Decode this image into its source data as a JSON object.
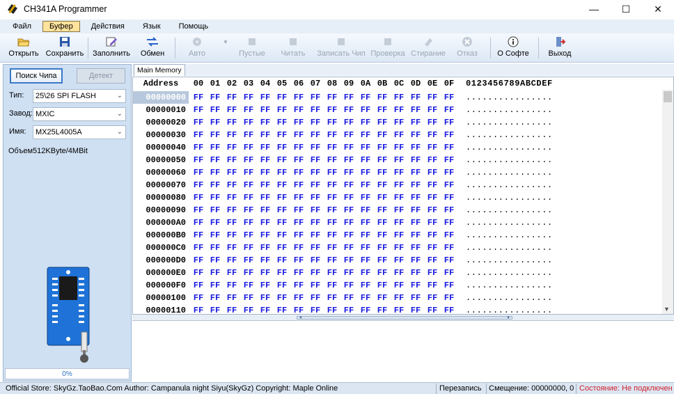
{
  "window": {
    "title": "CH341A Programmer",
    "minimize": "—",
    "maximize": "☐",
    "close": "✕"
  },
  "menu": {
    "items": [
      {
        "label": "Файл",
        "active": false
      },
      {
        "label": "Буфер",
        "active": true
      },
      {
        "label": "Действия",
        "active": false
      },
      {
        "label": "Язык",
        "active": false
      },
      {
        "label": "Помощь",
        "active": false
      }
    ]
  },
  "toolbar": {
    "open": "Открыть",
    "save": "Сохранить",
    "fill": "Заполнить",
    "swap": "Обмен",
    "auto": "Авто",
    "blank": "Пустые",
    "read": "Читать",
    "write": "Записать Чип",
    "verify": "Проверка",
    "erase": "Стирание",
    "cancel": "Отказ",
    "about": "О Софте",
    "exit": "Выход"
  },
  "left": {
    "search_btn": "Поиск Чипа",
    "detect_btn": "Детект",
    "type_label": "Тип:",
    "type_value": "25\\26 SPI FLASH",
    "vendor_label": "Завод:",
    "vendor_value": "MXIC",
    "name_label": "Имя:",
    "name_value": "MX25L4005A",
    "size_label": "Объем",
    "size_value": "512KByte/4MBit",
    "progress": "0%"
  },
  "memory": {
    "tab": "Main Memory",
    "address_header": "Address",
    "columns": [
      "00",
      "01",
      "02",
      "03",
      "04",
      "05",
      "06",
      "07",
      "08",
      "09",
      "0A",
      "0B",
      "0C",
      "0D",
      "0E",
      "0F"
    ],
    "ascii_header": "0123456789ABCDEF",
    "fill_byte": "FF",
    "ascii_row": "................",
    "rows": [
      "00000000",
      "00000010",
      "00000020",
      "00000030",
      "00000040",
      "00000050",
      "00000060",
      "00000070",
      "00000080",
      "00000090",
      "000000A0",
      "000000B0",
      "000000C0",
      "000000D0",
      "000000E0",
      "000000F0",
      "00000100",
      "00000110"
    ]
  },
  "status": {
    "store": "Official Store: SkyGz.TaoBao.Com Author: Campanula night Siyu(SkyGz) Copyright: Maple Online",
    "mode": "Перезапись",
    "offset": "Смещение: 00000000, 0",
    "state": "Состояние: Не подключен"
  },
  "colors": {
    "hex_bytes": "#1a1ae0",
    "status_error": "#d0202a",
    "panel_bg": "#cfe0f3",
    "menu_active": "#ffe29b"
  }
}
